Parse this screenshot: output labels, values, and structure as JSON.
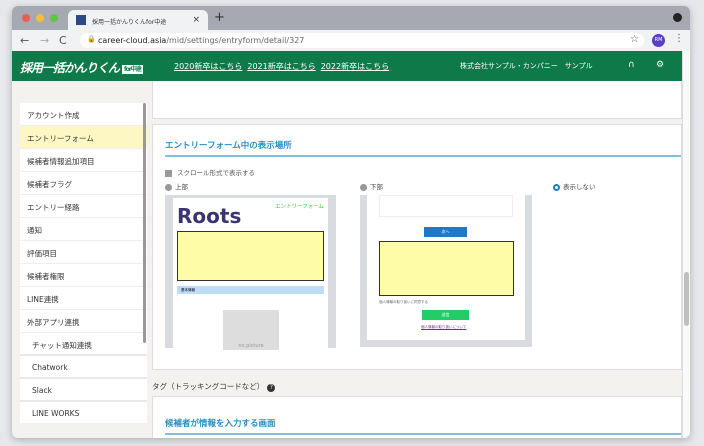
{
  "browser": {
    "tab_title": "採用一括かんりくんfor中途",
    "tab_close": "×",
    "new_tab": "+",
    "url_domain": "career-cloud.asia",
    "url_path": "/mid/settings/entryform/detail/327",
    "avatar": "RM"
  },
  "header": {
    "logo": "採用一括かんりくん",
    "logo_badge": "for中途",
    "links": [
      "2020新卒はこちら",
      "2021新卒はこちら",
      "2022新卒はこちら"
    ],
    "company": "株式会社サンプル・カンパニー　サンプル"
  },
  "sidebar": {
    "items": [
      {
        "label": "アカウント作成"
      },
      {
        "label": "エントリーフォーム",
        "active": true
      },
      {
        "label": "候補者情報追加項目"
      },
      {
        "label": "候補者フラグ"
      },
      {
        "label": "エントリー経路"
      },
      {
        "label": "通知"
      },
      {
        "label": "評価項目"
      },
      {
        "label": "候補者権限"
      },
      {
        "label": "LINE連携"
      },
      {
        "label": "外部アプリ連携"
      },
      {
        "label": "チャット通知連携"
      },
      {
        "label": "Chatwork"
      },
      {
        "label": "Slack"
      },
      {
        "label": "LINE WORKS"
      }
    ]
  },
  "main": {
    "section_title": "エントリーフォーム中の表示場所",
    "scroll_checkbox": "スクロール形式で表示する",
    "radios": [
      {
        "label": "上部",
        "selected": false
      },
      {
        "label": "下部",
        "selected": false
      },
      {
        "label": "表示しない",
        "selected": true
      }
    ],
    "preview_top": {
      "logo": "Roots",
      "form_label": "エントリーフォーム",
      "band": "基本情報",
      "photo_label": "no picture"
    },
    "preview_bottom": {
      "next_button": "次へ",
      "agree_text": "個人情報の取り扱いに同意する",
      "submit_button": "送信",
      "privacy_link": "個人情報の取り扱いについて"
    },
    "tag_label": "タグ（トラッキングコードなど）",
    "tag_help": "?",
    "section2_title": "候補者が情報を入力する画面"
  },
  "colors": {
    "header": "#0e7a4a",
    "accent": "#2a8ec4",
    "active_item": "#fdf7c4",
    "highlight_box": "#fffca8"
  }
}
